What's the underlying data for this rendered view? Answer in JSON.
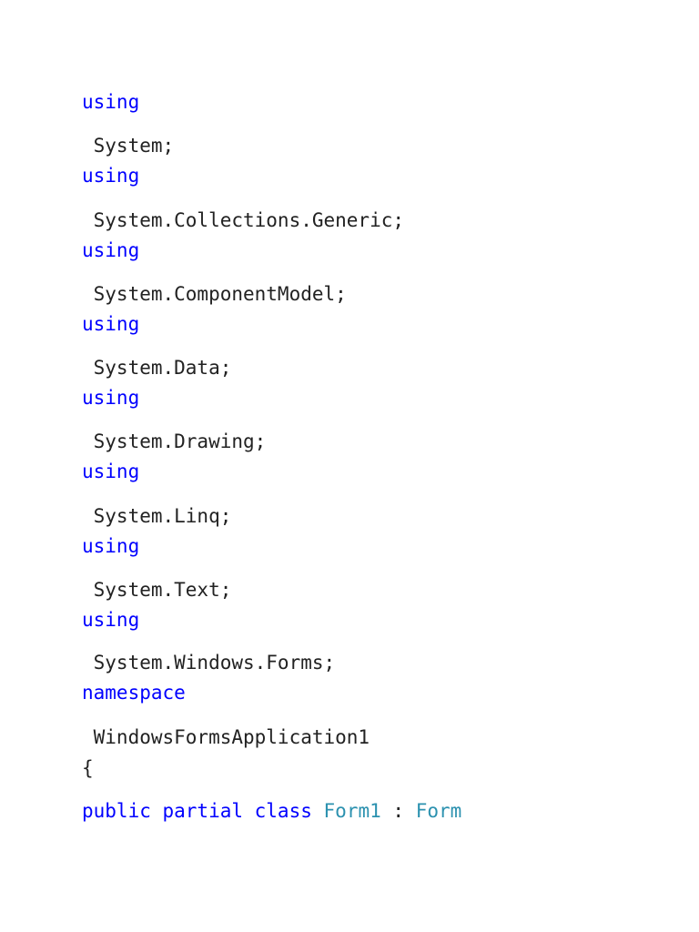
{
  "document": {
    "lines": [
      {
        "kw": "using",
        "plain": " System;"
      },
      {
        "kw": "using",
        "plain": " System.Collections.Generic;"
      },
      {
        "kw": "using",
        "plain": " System.ComponentModel;"
      },
      {
        "kw": "using",
        "plain": " System.Data;"
      },
      {
        "kw": "using",
        "plain": " System.Drawing;"
      },
      {
        "kw": "using",
        "plain": " System.Linq;"
      },
      {
        "kw": "using",
        "plain": " System.Text;"
      },
      {
        "kw": "using",
        "plain": " System.Windows.Forms;"
      },
      {
        "kw": "namespace",
        "plain": " WindowsFormsApplication1"
      }
    ],
    "brace_open": "{",
    "class_decl": {
      "modifiers": "public partial class",
      "name": "Form1",
      "separator": " : ",
      "base": "Form"
    }
  },
  "colors": {
    "keyword": "#0000ff",
    "type": "#2b91af",
    "text": "#222222"
  }
}
